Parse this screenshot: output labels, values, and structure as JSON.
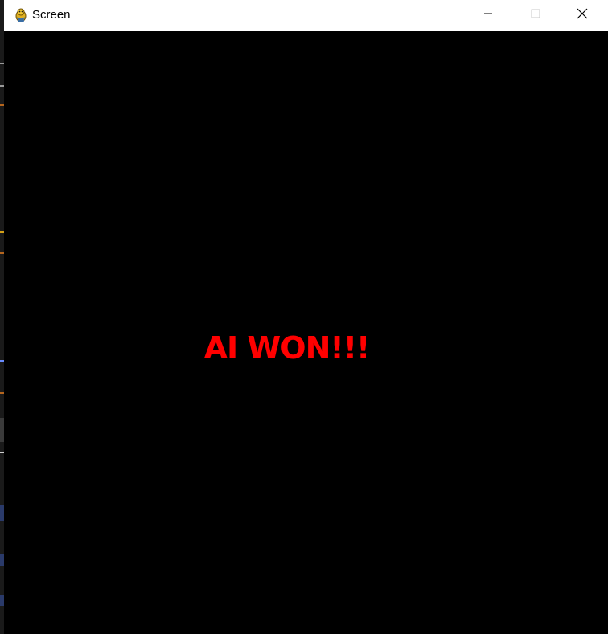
{
  "window": {
    "title": "Screen",
    "app_icon": "pygame-snake-icon",
    "controls": {
      "minimize_icon": "minimize-icon",
      "maximize_icon": "maximize-icon",
      "close_icon": "close-icon"
    }
  },
  "game": {
    "message": "AI WON!!!",
    "message_color": "#ff0000",
    "background_color": "#000000"
  }
}
